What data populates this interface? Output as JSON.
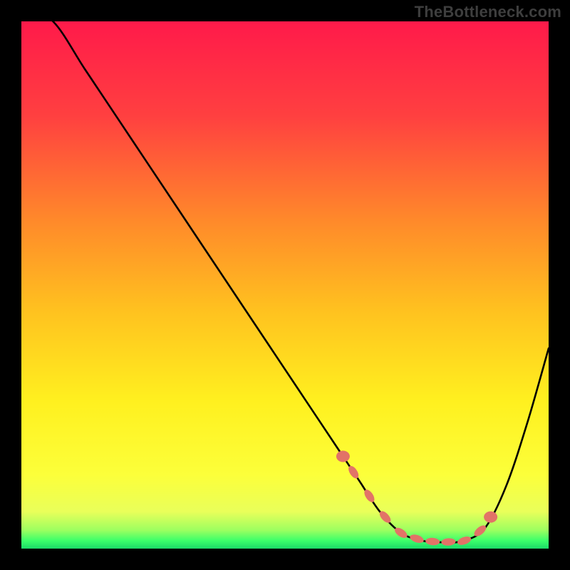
{
  "attribution": "TheBottleneck.com",
  "gradient_stops": [
    {
      "offset": 0.0,
      "color": "#ff1a4a"
    },
    {
      "offset": 0.18,
      "color": "#ff4040"
    },
    {
      "offset": 0.38,
      "color": "#ff8a2a"
    },
    {
      "offset": 0.55,
      "color": "#ffc21f"
    },
    {
      "offset": 0.72,
      "color": "#fff01f"
    },
    {
      "offset": 0.86,
      "color": "#fcff3a"
    },
    {
      "offset": 0.93,
      "color": "#e9ff5a"
    },
    {
      "offset": 0.965,
      "color": "#9cff60"
    },
    {
      "offset": 0.985,
      "color": "#3bff6a"
    },
    {
      "offset": 1.0,
      "color": "#1bd968"
    }
  ],
  "chart_data": {
    "type": "line",
    "title": "",
    "xlabel": "",
    "ylabel": "",
    "xlim": [
      0,
      100
    ],
    "ylim": [
      0,
      100
    ],
    "x": [
      0,
      6,
      12,
      18,
      24,
      30,
      36,
      42,
      48,
      54,
      60,
      64,
      68,
      72,
      76,
      80,
      84,
      88,
      92,
      96,
      100
    ],
    "values": [
      103,
      100,
      91,
      82,
      73,
      64,
      55,
      46,
      37,
      28,
      19,
      13,
      7,
      3,
      1.5,
      1.2,
      1.5,
      4,
      12,
      24,
      38
    ],
    "optimal_markers_x": [
      63,
      66,
      69,
      72,
      75,
      78,
      81,
      84,
      87
    ],
    "optimal_endpoints_x": [
      61,
      89
    ],
    "marker_color": "#e27367",
    "curve_color": "#000000"
  }
}
